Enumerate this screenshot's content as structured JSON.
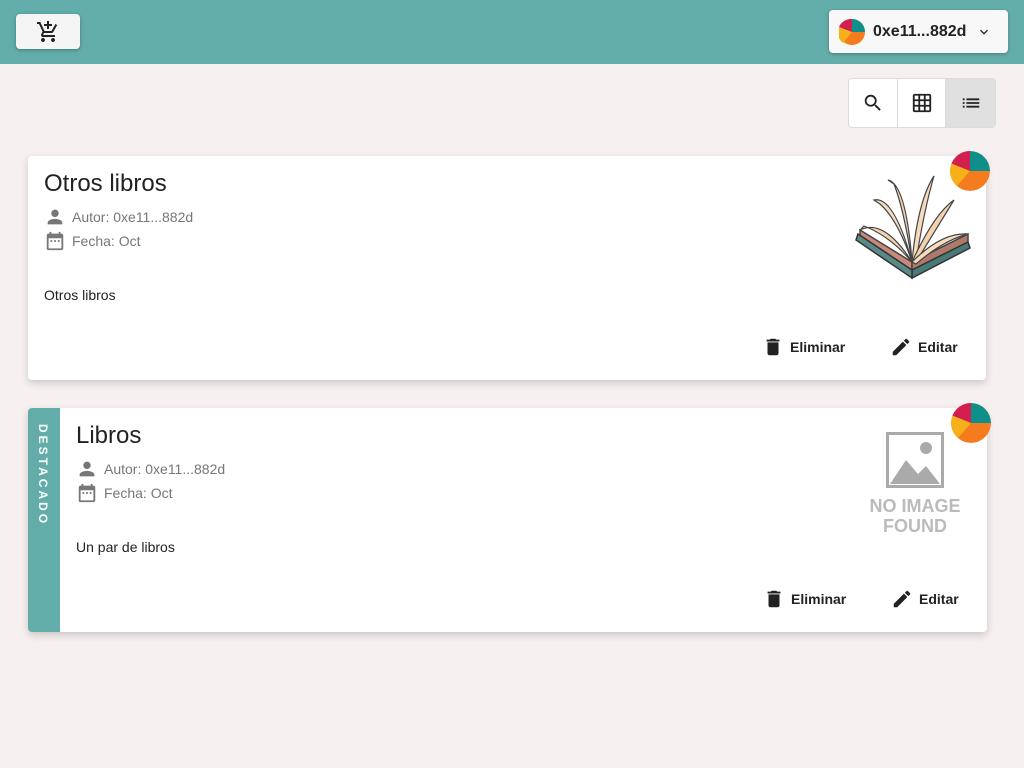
{
  "header": {
    "account_address": "0xe11...882d"
  },
  "icons": {
    "cart": "add-shopping-cart-icon",
    "search": "search-icon",
    "grid": "grid-view-icon",
    "list": "list-view-icon",
    "author": "person-icon",
    "date": "calendar-icon",
    "delete": "trash-icon",
    "edit": "pencil-icon"
  },
  "colors": {
    "accent": "#62aca9",
    "background": "#f7f0f0"
  },
  "cards": [
    {
      "title": "Otros libros",
      "author": "Autor: 0xe11...882d",
      "date": "Fecha: Oct",
      "description": "Otros libros",
      "delete_label": "Eliminar",
      "edit_label": "Editar",
      "image": "open-book"
    },
    {
      "title": "Libros",
      "featured_label": "DESTACADO",
      "author": "Autor: 0xe11...882d",
      "date": "Fecha: Oct",
      "description": "Un par de libros",
      "delete_label": "Eliminar",
      "edit_label": "Editar",
      "image": "no-image",
      "no_image_line1": "NO IMAGE",
      "no_image_line2": "FOUND"
    }
  ]
}
